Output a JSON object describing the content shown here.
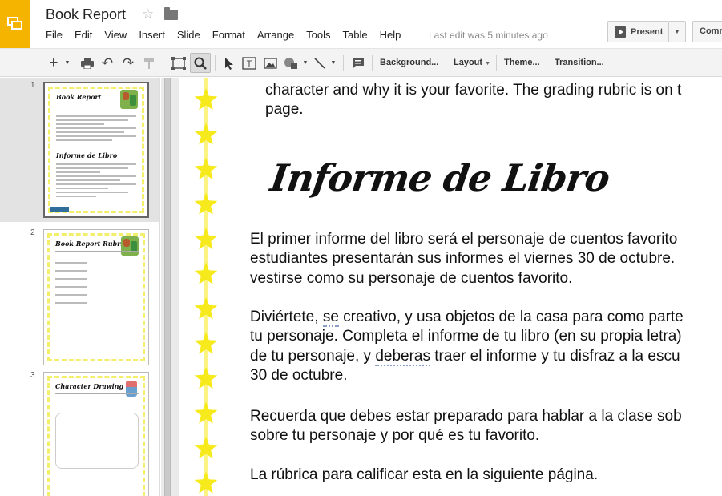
{
  "app": {
    "title": "Book Report",
    "menu": [
      "File",
      "Edit",
      "View",
      "Insert",
      "Slide",
      "Format",
      "Arrange",
      "Tools",
      "Table",
      "Help"
    ],
    "last_edit": "Last edit was 5 minutes ago",
    "present_label": "Present",
    "comments_label": "Comm"
  },
  "toolbar": {
    "background_label": "Background...",
    "layout_label": "Layout",
    "theme_label": "Theme...",
    "transition_label": "Transition..."
  },
  "filmstrip": {
    "slides": [
      {
        "number": "1",
        "title": "Book Report",
        "subtitle": "Informe de Libro"
      },
      {
        "number": "2",
        "title": "Book Report Rubric"
      },
      {
        "number": "3",
        "title": "Character Drawing"
      }
    ]
  },
  "slide": {
    "intro_line1": "character and why it is your favorite. The grading rubric is on t",
    "intro_line2": "page.",
    "heading": "Informe de Libro",
    "para1": [
      "El primer informe del libro será el personaje de cuentos favorito",
      "estudiantes presentarán sus informes el viernes 30 de octubre.",
      "vestirse como su personaje de cuentos favorito."
    ],
    "para2_line1_a": "Diviértete, ",
    "para2_line1_b": "se",
    "para2_line1_c": " creativo, y usa objetos de la casa para como parte",
    "para2_line2": "tu personaje. Completa el informe de tu libro (en su propia letra)",
    "para2_line3_a": "de tu personaje, y ",
    "para2_line3_b": "deberas",
    "para2_line3_c": " traer el informe y tu disfraz a la escu",
    "para2_line4": "30 de octubre.",
    "para3": [
      "Recuerda que debes estar preparado para hablar a la clase sob",
      "sobre tu personaje y por qué es tu favorito."
    ],
    "para4": "La rúbrica para calificar esta en la siguiente página."
  },
  "colors": {
    "logo": "#f4b400",
    "star": "#f7ea1c",
    "thumb_border": "#f3ef6a"
  }
}
